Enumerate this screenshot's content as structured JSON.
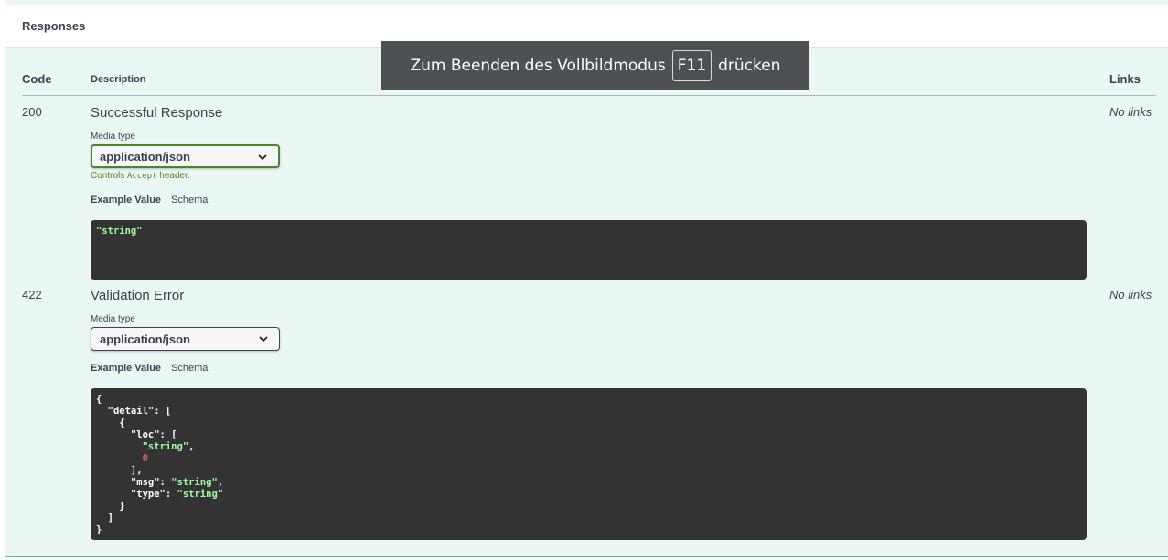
{
  "section": {
    "title": "Responses"
  },
  "table": {
    "col_code": "Code",
    "col_description": "Description",
    "col_links": "Links"
  },
  "responses": [
    {
      "code": "200",
      "description": "Successful Response",
      "links": "No links",
      "media_type_label": "Media type",
      "media_type_value": "application/json",
      "controls_prefix": "Controls ",
      "controls_code": "Accept",
      "controls_suffix": " header.",
      "tab_example": "Example Value",
      "tab_schema": "Schema",
      "example": "\"string\""
    },
    {
      "code": "422",
      "description": "Validation Error",
      "links": "No links",
      "media_type_label": "Media type",
      "media_type_value": "application/json",
      "tab_example": "Example Value",
      "tab_schema": "Schema"
    }
  ],
  "fullscreen_notice": {
    "before": "Zum Beenden des Vollbildmodus",
    "key": "F11",
    "after": "drücken"
  },
  "colors": {
    "success_green": "#49cc90",
    "accept_green": "#45882a",
    "code_bg": "#333333",
    "string_green": "#a2fca2",
    "number_red": "#d36363"
  }
}
